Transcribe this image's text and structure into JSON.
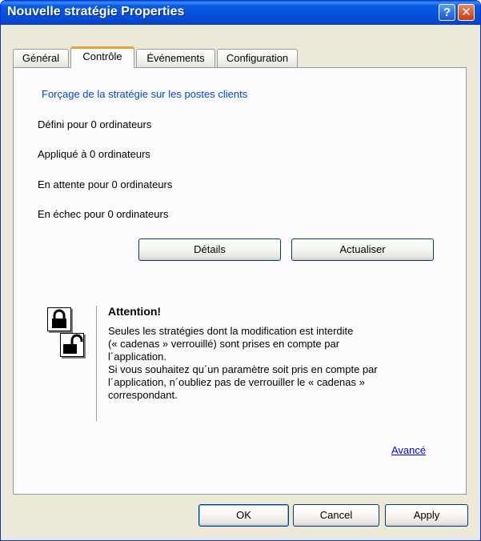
{
  "window": {
    "title": "Nouvelle stratégie Properties",
    "help_button": "?",
    "close_button": "✕"
  },
  "tabs": [
    {
      "label": "Général",
      "active": false
    },
    {
      "label": "Contrôle",
      "active": true
    },
    {
      "label": "Événements",
      "active": false
    },
    {
      "label": "Configuration",
      "active": false
    }
  ],
  "enforcement": {
    "group_title": "Forçage de la stratégie sur les postes clients",
    "lines": [
      "Défini pour 0 ordinateurs",
      "Appliqué à 0 ordinateurs",
      "En attente pour 0 ordinateurs",
      "En échec pour 0 ordinateurs"
    ],
    "details_button": "Détails",
    "refresh_button": "Actualiser"
  },
  "warning": {
    "title": "Attention!",
    "body_lines": [
      "Seules les stratégies dont la modification est interdite",
      "(« cadenas » verrouillé) sont prises en compte par",
      "l´application.",
      "Si vous souhaitez qu´un paramètre soit pris en compte par",
      "l´application, n´oubliez pas de verrouiller le « cadenas »",
      "correspondant."
    ],
    "advanced_link": "Avancé",
    "icons": [
      "lock-closed-icon",
      "lock-open-icon"
    ]
  },
  "footer": {
    "ok_button": "OK",
    "cancel_button": "Cancel",
    "apply_button": "Apply"
  },
  "colors": {
    "titlebar": "#0653dc",
    "legend_text": "#0046d5",
    "link": "#0000ff",
    "active_tab_accent": "#e6a23c"
  }
}
